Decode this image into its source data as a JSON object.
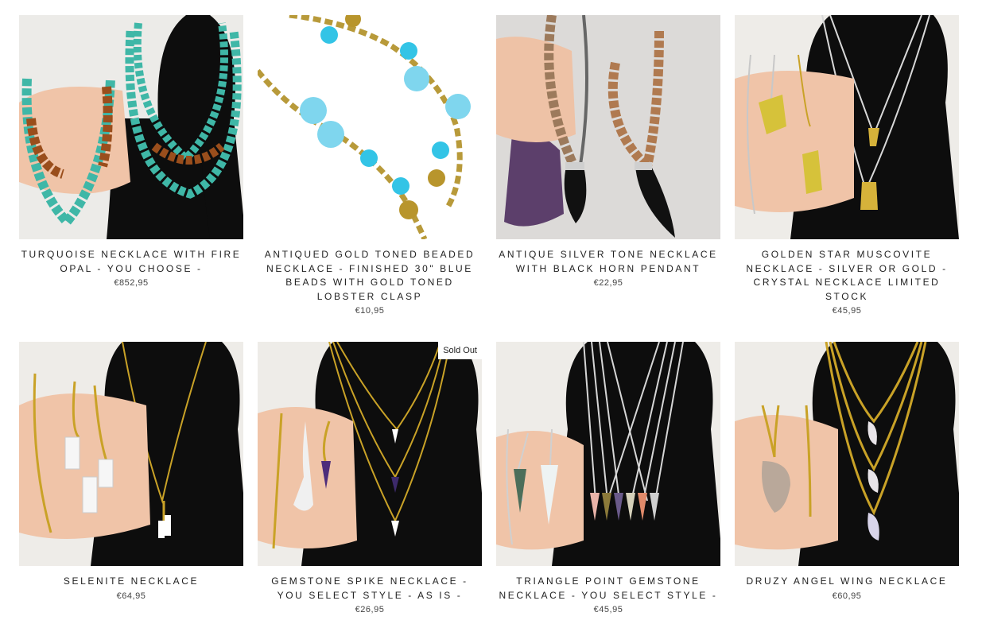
{
  "products": [
    {
      "title": "TURQUOISE NECKLACE WITH FIRE OPAL - YOU CHOOSE -",
      "price": "€852,95",
      "image_alt": "turquoise necklace with fire opal beads on black bust"
    },
    {
      "title": "ANTIQUED GOLD TONED BEADED NECKLACE - FINISHED 30\" BLUE BEADS WITH GOLD TONED LOBSTER CLASP",
      "price": "€10,95",
      "image_alt": "gold chain with blue glass beads"
    },
    {
      "title": "ANTIQUE SILVER TONE NECKLACE WITH BLACK HORN PENDANT",
      "price": "€22,95",
      "image_alt": "beaded necklace with black horn pendant"
    },
    {
      "title": "GOLDEN STAR MUSCOVITE NECKLACE - SILVER OR GOLD - CRYSTAL NECKLACE LIMITED STOCK",
      "price": "€45,95",
      "image_alt": "golden crystal pendants on chains"
    },
    {
      "title": "SELENITE NECKLACE",
      "price": "€64,95",
      "image_alt": "selenite point pendants on gold chains"
    },
    {
      "title": "GEMSTONE SPIKE NECKLACE - YOU SELECT STYLE - AS IS -",
      "price": "€26,95",
      "image_alt": "gemstone spike pendants on gold chains",
      "badge": "Sold Out"
    },
    {
      "title": "TRIANGLE POINT GEMSTONE NECKLACE - YOU SELECT STYLE -",
      "price": "€45,95",
      "image_alt": "triangle gemstone points on silver chains"
    },
    {
      "title": "DRUZY ANGEL WING NECKLACE",
      "price": "€60,95",
      "image_alt": "druzy angel wing pendants on gold chains"
    }
  ],
  "colors": {
    "bust": "#0d0d0d",
    "turquoise": "#3fb7a7",
    "amber": "#9a4e1c",
    "gold": "#c9a227",
    "blue_bead": "#33c4e6",
    "silver": "#c8c8c8"
  }
}
